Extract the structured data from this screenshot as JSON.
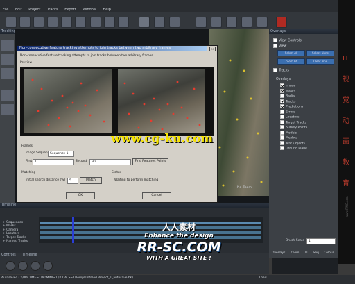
{
  "menu": [
    "File",
    "Edit",
    "Project",
    "Tracks",
    "Export",
    "Window",
    "Help"
  ],
  "tabs": {
    "tracking": "Tracking",
    "overlays": "Overlays",
    "timeline": "Timeline",
    "controls": "Controls"
  },
  "dialog": {
    "title": "Non-consecutive feature tracking attempts to join tracks between two arbitrary frames",
    "description": "Non-consecutive feature tracking attempts to join tracks between two arbitrary frames",
    "preview_label": "Preview",
    "frames_label": "Frames",
    "image_sequence_label": "Image Sequence",
    "image_sequence_value": "Sequence 1",
    "first_label": "First",
    "first_value": "1",
    "second_label": "Second",
    "second_value": "90",
    "find_button": "Find Features Points",
    "matching_label": "Matching",
    "initial_search_label": "Initial search distance (%)",
    "initial_search_value": "5",
    "match_button": "Match",
    "status_label": "Status",
    "status_text": "Waiting to perform matching",
    "ok_button": "OK",
    "cancel_button": "Cancel"
  },
  "overlays_panel": {
    "view_controls": "View Controls",
    "view": "View",
    "buttons": [
      "Select All",
      "Select None",
      "Zoom Fit",
      "Clear Pins"
    ],
    "tracks": "Tracks",
    "overlays_title": "Overlays",
    "items": [
      {
        "label": "Image",
        "checked": true
      },
      {
        "label": "Masks",
        "checked": true
      },
      {
        "label": "Radial",
        "checked": false
      },
      {
        "label": "Tracks",
        "checked": true
      },
      {
        "label": "Predictions",
        "checked": true
      },
      {
        "label": "Errors",
        "checked": false
      },
      {
        "label": "Locators",
        "checked": false
      },
      {
        "label": "Target Tracks",
        "checked": false
      },
      {
        "label": "Survey Points",
        "checked": false
      },
      {
        "label": "Models",
        "checked": false
      },
      {
        "label": "Meshes",
        "checked": false
      },
      {
        "label": "Test Objects",
        "checked": false
      },
      {
        "label": "Ground Plane",
        "checked": false
      }
    ],
    "brush_scale_label": "Brush Scale",
    "brush_scale_value": "1"
  },
  "viewer": {
    "no_zoom": "No Zoom"
  },
  "timeline": {
    "title": "Timeline",
    "tracks": [
      "Sequences",
      "Masks",
      "Camera",
      "Locators",
      "Target Tracks",
      "Named Tracks"
    ]
  },
  "bottom_tabs": [
    "Overlays",
    "Zoom",
    "TT",
    "Seq",
    "Colour"
  ],
  "status_bar": {
    "path": "Autosaved C:\\DOCUME~1\\ADMINI~1\\LOCALS~1\\Temp\\Untitled Project_T_autosave.bk)",
    "right": "Load"
  },
  "watermarks": {
    "cgku": "www.cg-ku.com",
    "rr_top": "人人素材",
    "rr_mid": "Enhance the design",
    "rr_logo": "RR-SC.COM",
    "rr_bottom": "WITH A GREAT SITE !",
    "side": "IT视觉动画教育",
    "url_right": "www.ITMG.com"
  },
  "colors": {
    "accent_blue": "#3b6fb0",
    "dialog_title": "#0a246a",
    "track_marker": "#e63b2e"
  }
}
